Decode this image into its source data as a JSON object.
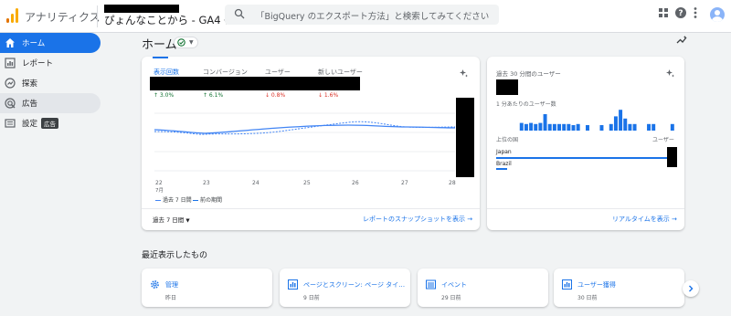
{
  "header": {
    "app_title": "アナリティクス",
    "property_name": "ぴょんなことから - GA4",
    "search_placeholder": "「BigQuery のエクスポート方法」と検索してみてください",
    "icons": [
      "apps-grid-icon",
      "help-icon",
      "more-vert-icon",
      "account-avatar"
    ]
  },
  "sidebar": {
    "items": [
      {
        "label": "ホーム",
        "icon": "home-icon",
        "active": true
      },
      {
        "label": "レポート",
        "icon": "reports-icon"
      },
      {
        "label": "探索",
        "icon": "explore-icon"
      },
      {
        "label": "広告",
        "icon": "advertising-icon"
      },
      {
        "label": "設定",
        "icon": "settings-icon"
      }
    ],
    "tooltip": "広告"
  },
  "home": {
    "title": "ホーム"
  },
  "overview": {
    "tabs": [
      {
        "label": "表示回数",
        "delta": "↑ 3.0%",
        "dir": "up"
      },
      {
        "label": "コンバージョン",
        "delta": "↑ 6.1%",
        "dir": "up"
      },
      {
        "label": "ユーザー",
        "delta": "↓ 0.8%",
        "dir": "down"
      },
      {
        "label": "新しいユーザー",
        "delta": "↓ 1.6%",
        "dir": "down"
      }
    ],
    "x_ticks": [
      "22",
      "23",
      "24",
      "25",
      "26",
      "27",
      "28"
    ],
    "x_sub": "7月",
    "legend": [
      "過去 7 日間",
      "前の期間"
    ],
    "range": "過去 7 日間",
    "link": "レポートのスナップショットを表示"
  },
  "realtime": {
    "title": "過去 30 分間のユーザー",
    "subtitle": "1 分あたりのユーザー数",
    "col_country": "上位の国",
    "col_users": "ユーザー",
    "countries": [
      "Japan",
      "Brazil"
    ],
    "per_minute": [
      0,
      0,
      0,
      0,
      0,
      0,
      0,
      0,
      0,
      0,
      0,
      0,
      0,
      0,
      0,
      0,
      0,
      0,
      0,
      0,
      0,
      0,
      0,
      0,
      0,
      0,
      0,
      0,
      0,
      0
    ],
    "link": "リアルタイムを表示"
  },
  "recent": {
    "title": "最近表示したもの",
    "items": [
      {
        "title": "管理",
        "date": "昨日",
        "icon": "settings-gear-icon"
      },
      {
        "title": "ページとスクリーン: ページ タイ…",
        "date": "9 日前",
        "icon": "report-chart-icon"
      },
      {
        "title": "イベント",
        "date": "29 日前",
        "icon": "report-table-icon"
      },
      {
        "title": "ユーザー獲得",
        "date": "30 日前",
        "icon": "report-chart-icon"
      }
    ]
  },
  "colors": {
    "accent": "#1a73e8",
    "positive": "#137333",
    "negative": "#d93025"
  }
}
